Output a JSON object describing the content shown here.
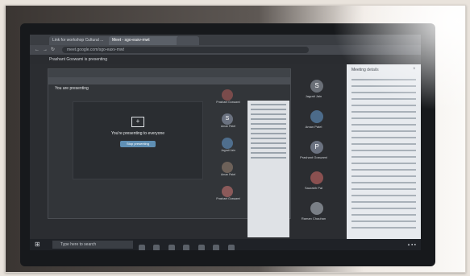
{
  "browser": {
    "tabs": [
      "Link for workshop Cultural ...",
      "Meet - sgo-eaxv-mwt",
      ""
    ],
    "url": "meet.google.com/sgo-eaxv-mwt"
  },
  "meet": {
    "presenting_banner": "Prashant Goswami is presenting"
  },
  "inner": {
    "presenting_label": "You are presenting",
    "share_text": "You're presenting to everyone",
    "stop_button": "Stop presenting"
  },
  "participants_left": [
    {
      "name": "Prashant Goswami"
    },
    {
      "name": "Aman Patel"
    },
    {
      "name": "Jagrati Jain"
    },
    {
      "name": "Aman Patel"
    },
    {
      "name": "Prashant Goswami"
    }
  ],
  "participants_right": [
    {
      "initial": "S",
      "name": "Jagrati Jain"
    },
    {
      "initial": "",
      "name": "Aman Patel"
    },
    {
      "initial": "P",
      "name": "Prashant Goswami"
    },
    {
      "initial": "",
      "name": "Saurabh Pal"
    },
    {
      "initial": "",
      "name": "Raman Chauhan"
    }
  ],
  "side_panel": {
    "title": "Meeting details"
  },
  "taskbar": {
    "search_placeholder": "Type here to search"
  },
  "colors": {
    "accent": "#5f8fb4",
    "screen_bg": "#2b2d31"
  }
}
